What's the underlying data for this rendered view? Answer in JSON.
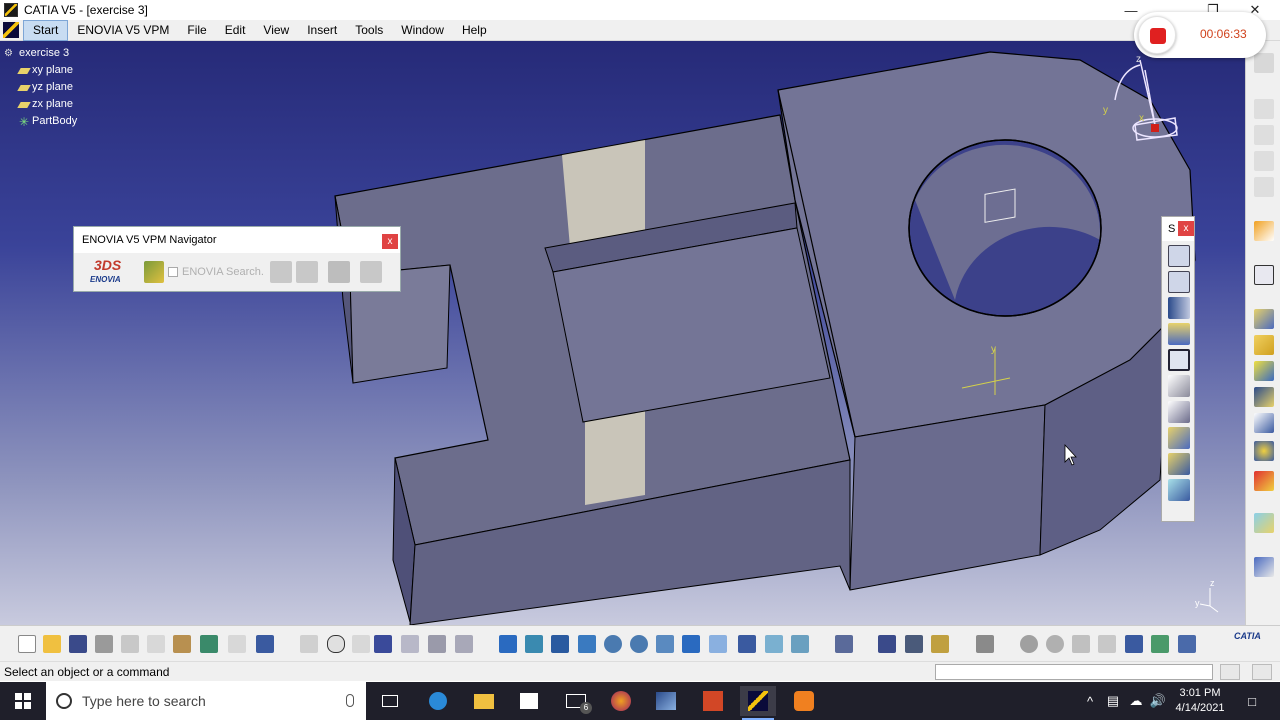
{
  "window": {
    "title": "CATIA V5 - [exercise 3]",
    "controls": [
      "minimize-icon",
      "restore-icon",
      "close-icon"
    ]
  },
  "menu": {
    "items": [
      "Start",
      "ENOVIA V5 VPM",
      "File",
      "Edit",
      "View",
      "Insert",
      "Tools",
      "Window",
      "Help"
    ]
  },
  "recorder": {
    "time": "00:06:33"
  },
  "tree": {
    "root": "exercise 3",
    "children": [
      "xy plane",
      "yz plane",
      "zx plane",
      "PartBody"
    ]
  },
  "navigator": {
    "title": "ENOVIA V5 VPM Navigator",
    "logo_top": "3DS",
    "logo_bottom": "ENOVIA",
    "search_placeholder": "ENOVIA Search..."
  },
  "floating_toolbar": {
    "title": "S"
  },
  "statusbar": {
    "message": "Select an object or a command"
  },
  "compass": {
    "x": "x",
    "y": "y",
    "z": "z"
  },
  "axis_triad": {
    "y": "y",
    "z": "z"
  },
  "taskbar": {
    "search_placeholder": "Type here to search",
    "mail_badge": "6",
    "time": "3:01 PM",
    "date": "4/14/2021"
  },
  "colors": {
    "viewport_top": "#262a78",
    "viewport_bottom": "#c8cade",
    "part_fill": "#6f7090",
    "record": "#e02020",
    "recorder_time": "#d0421c"
  }
}
